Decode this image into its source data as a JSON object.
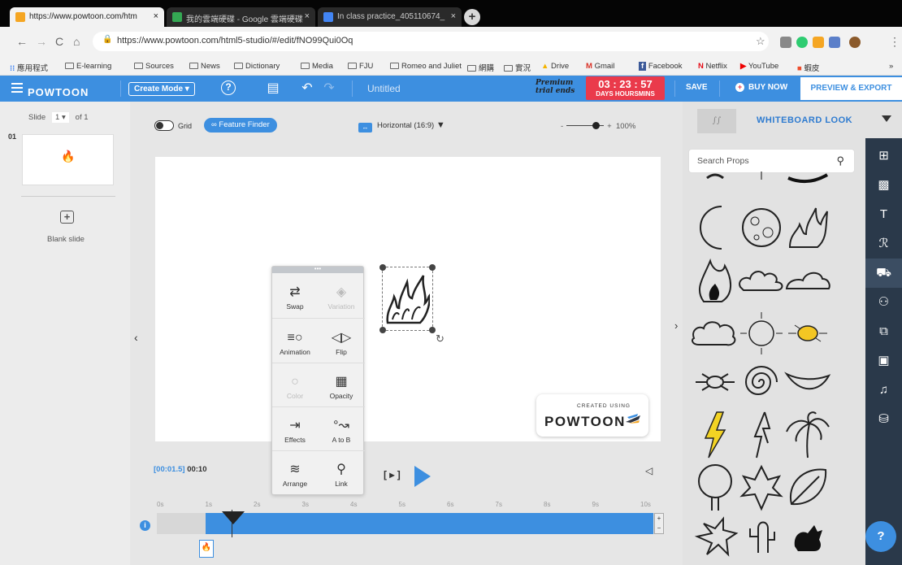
{
  "browser": {
    "tabs": [
      {
        "title": "https://www.powtoon.com/htm",
        "favicon": "powtoon-favicon"
      },
      {
        "title": "我的雲端硬碟 - Google 雲端硬碟",
        "favicon": "drive-favicon"
      },
      {
        "title": "In class practice_405110674_",
        "favicon": "docs-favicon"
      }
    ],
    "tab_close": "×",
    "new_tab": "+",
    "url": "https://www.powtoon.com/html5-studio/#/edit/fNO99Qui0Oq",
    "nav": {
      "back": "←",
      "forward": "→",
      "reload": "C",
      "home": "⌂"
    },
    "star": "☆",
    "menu_glyph": "⋮"
  },
  "bookmarks": [
    {
      "label": "應用程式",
      "icon": "apps-icon"
    },
    {
      "label": "E-learning",
      "icon": "folder-icon"
    },
    {
      "label": "Sources",
      "icon": "folder-icon"
    },
    {
      "label": "News",
      "icon": "folder-icon"
    },
    {
      "label": "Dictionary",
      "icon": "folder-icon"
    },
    {
      "label": "Media",
      "icon": "folder-icon"
    },
    {
      "label": "FJU",
      "icon": "folder-icon"
    },
    {
      "label": "Romeo and Juliet",
      "icon": "folder-icon"
    },
    {
      "label": "網購",
      "icon": "folder-icon"
    },
    {
      "label": "實況",
      "icon": "folder-icon"
    },
    {
      "label": "Drive",
      "icon": "drive-icon"
    },
    {
      "label": "Gmail",
      "icon": "gmail-icon"
    },
    {
      "label": "Facebook",
      "icon": "facebook-icon"
    },
    {
      "label": "Netflix",
      "icon": "netflix-icon"
    },
    {
      "label": "YouTube",
      "icon": "youtube-icon"
    },
    {
      "label": "蝦皮",
      "icon": "shopee-icon"
    }
  ],
  "bookmarks_more": "»",
  "header": {
    "logo": "POWTOON",
    "mode": "Create Mode ▾",
    "title": "Untitled",
    "premium": "Premium",
    "trial_ends": "trial ends",
    "timer": "03 : 23 : 57",
    "timer_label": "DAYS HOURSMINS",
    "save": "SAVE",
    "buy_now": "BUY NOW",
    "buy_mark": "+",
    "export": "PREVIEW & EXPORT",
    "accent": "#3d8fe0",
    "timer_color": "#ea3a4b"
  },
  "slides": {
    "label": "Slide",
    "current": "1 ▾",
    "total": "of 1",
    "number": "01",
    "blank_label": "Blank slide",
    "blank_glyph": "+"
  },
  "toolbar": {
    "grid": "Grid",
    "feature_finder": "Feature Finder",
    "orientation": "Horizontal (16:9)",
    "orientation_glyph": "↔",
    "zoom_minus": "-",
    "zoom_plus": "+",
    "zoom": "100%"
  },
  "stage": {
    "credit_top": "CREATED USING",
    "credit_brand": "POWTOON"
  },
  "context_menu": {
    "items": [
      {
        "label": "Swap",
        "glyph": "⇄",
        "enabled": true
      },
      {
        "label": "Variation",
        "glyph": "◈",
        "enabled": false
      },
      {
        "label": "Animation",
        "glyph": "≡○",
        "enabled": true
      },
      {
        "label": "Flip",
        "glyph": "◁▷",
        "enabled": true
      },
      {
        "label": "Color",
        "glyph": "○",
        "enabled": false
      },
      {
        "label": "Opacity",
        "glyph": "▦",
        "enabled": true
      },
      {
        "label": "Effects",
        "glyph": "⇥",
        "enabled": true
      },
      {
        "label": "A to B",
        "glyph": "°↝",
        "enabled": true
      },
      {
        "label": "Arrange",
        "glyph": "≋",
        "enabled": true
      },
      {
        "label": "Link",
        "glyph": "⚲",
        "enabled": true
      }
    ]
  },
  "playback": {
    "current": "[00:01.5]",
    "duration": "00:10",
    "play_bracket": "[ ▸ ]",
    "volume": "◁"
  },
  "timeline": {
    "ticks": [
      "0s",
      "1s",
      "2s",
      "3s",
      "4s",
      "5s",
      "6s",
      "7s",
      "8s",
      "9s",
      "10s"
    ],
    "info": "i",
    "head": "•••",
    "step_up": "+",
    "step_down": "−"
  },
  "props_panel": {
    "style": "WHITEBOARD LOOK",
    "search_placeholder": "Search Props",
    "items": [
      "eye-prop",
      "line-prop",
      "brush-stroke-prop",
      "crescent-moon-prop",
      "full-moon-prop",
      "fire-prop",
      "flame-prop",
      "cloud-prop",
      "flat-cloud-prop",
      "puffy-cloud-prop",
      "sun-prop",
      "bright-sun-prop",
      "burst-prop",
      "spiral-prop",
      "leaf-curl-prop",
      "lightning-prop",
      "lightning-bolt-prop",
      "palm-tree-prop",
      "tree-prop",
      "maple-leaf-prop",
      "big-leaf-prop",
      "oak-leaf-prop",
      "cactus-prop",
      "dog-prop"
    ]
  },
  "side_icons": [
    {
      "name": "layout-icon",
      "glyph": "⊞"
    },
    {
      "name": "background-icon",
      "glyph": "▩"
    },
    {
      "name": "text-icon",
      "glyph": "T"
    },
    {
      "name": "characters-icon",
      "glyph": "ℛ"
    },
    {
      "name": "props-icon",
      "glyph": "⛟"
    },
    {
      "name": "shapes-icon",
      "glyph": "⚇"
    },
    {
      "name": "images-icon",
      "glyph": "⧉"
    },
    {
      "name": "video-icon",
      "glyph": "▣"
    },
    {
      "name": "music-icon",
      "glyph": "♫"
    },
    {
      "name": "transitions-icon",
      "glyph": "⛁"
    }
  ],
  "help": "?"
}
